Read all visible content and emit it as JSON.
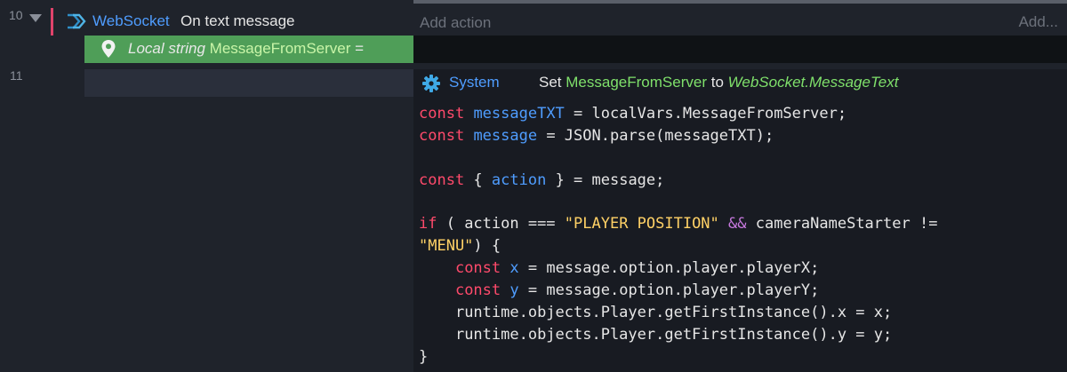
{
  "line_numbers": [
    "10",
    "11"
  ],
  "event": {
    "object": "WebSocket",
    "trigger": "On text message"
  },
  "add_action": {
    "placeholder": "Add action",
    "more": "Add..."
  },
  "local_var": {
    "prefix": "Local string",
    "name": "MessageFromServer",
    "suffix": "="
  },
  "action": {
    "object": "System",
    "set_word": "Set",
    "variable": "MessageFromServer",
    "to_word": "to",
    "expression": "WebSocket.MessageText"
  },
  "code": {
    "l1": {
      "k": "const",
      "v": "messageTXT",
      "rest": " = localVars.MessageFromServer;"
    },
    "l2": {
      "k": "const",
      "v": "message",
      "rest": " = JSON.parse(messageTXT);"
    },
    "l4": {
      "k": "const",
      "a": " { ",
      "v": "action",
      "rest": " } = message;"
    },
    "l6": {
      "k": "if",
      "a": " ( action === ",
      "s": "\"PLAYER POSITION\"",
      "op": " &&",
      "rest": " cameraNameStarter !="
    },
    "l7": {
      "s": "\"MENU\"",
      "rest": ") {"
    },
    "l8": {
      "pre": "    ",
      "k": "const",
      "v": "x",
      "rest": " = message.option.player.playerX;"
    },
    "l9": {
      "pre": "    ",
      "k": "const",
      "v": "y",
      "rest": " = message.option.player.playerY;"
    },
    "l10": {
      "pre": "    ",
      "rest": "runtime.objects.Player.getFirstInstance().x = x;"
    },
    "l11": {
      "pre": "    ",
      "rest": "runtime.objects.Player.getFirstInstance().y = y;"
    },
    "l12": {
      "rest": "}"
    }
  },
  "colors": {
    "keyword": "#ff4a6b",
    "variable": "#4f9dff",
    "string": "#ffd166",
    "operator": "#c678dd",
    "event_bar": "#e0436b",
    "local_bg": "#4f9e58"
  }
}
